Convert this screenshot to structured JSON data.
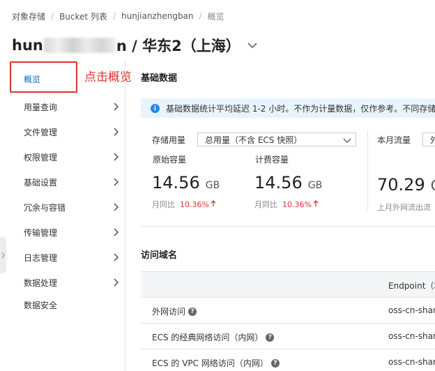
{
  "breadcrumb": {
    "items": [
      "对象存储",
      "Bucket 列表",
      "hunjianzhengban"
    ],
    "current": "概览"
  },
  "title": {
    "prefix": "hun",
    "suffix": "n / 华东2（上海）"
  },
  "sidebar": {
    "items": [
      {
        "label": "概览"
      },
      {
        "label": "用量查询"
      },
      {
        "label": "文件管理"
      },
      {
        "label": "权限管理"
      },
      {
        "label": "基础设置"
      },
      {
        "label": "冗余与容错"
      },
      {
        "label": "传输管理"
      },
      {
        "label": "日志管理"
      },
      {
        "label": "数据处理"
      },
      {
        "label": "数据安全"
      }
    ]
  },
  "annotation": {
    "text": "点击概览"
  },
  "basic_data": {
    "title": "基础数据",
    "info": "基础数据统计平均延迟 1-2 小时。不作为计量数据，仅作参考。不同存储",
    "storage_label": "存储用量",
    "storage_select": "总用量（不含 ECS 快照）",
    "raw_capacity_label": "原始容量",
    "raw_capacity_value": "14.56",
    "raw_capacity_unit": "GB",
    "raw_yoy_label": "月同比",
    "raw_yoy_value": "10.36%",
    "billing_capacity_label": "计费容量",
    "billing_capacity_value": "14.56",
    "billing_capacity_unit": "GB",
    "billing_yoy_label": "月同比",
    "billing_yoy_value": "10.36%",
    "traffic_label": "本月流量",
    "traffic_select": "外",
    "traffic_value": "70.29",
    "traffic_unit": "G",
    "traffic_sub": "上月外网流出流"
  },
  "access": {
    "title": "访问域名",
    "header": "Endpoint（地",
    "rows": [
      {
        "name": "外网访问",
        "endpoint": "oss-cn-shang"
      },
      {
        "name": "ECS 的经典网络访问（内网）",
        "endpoint": "oss-cn-shang"
      },
      {
        "name": "ECS 的 VPC 网络访问（内网）",
        "endpoint": "oss-cn-shang"
      }
    ]
  },
  "colors": {
    "accent": "#0070cc",
    "annotation_red": "#e0312f",
    "info_bg": "#e8f4fd",
    "increase_red": "#e0312f"
  }
}
